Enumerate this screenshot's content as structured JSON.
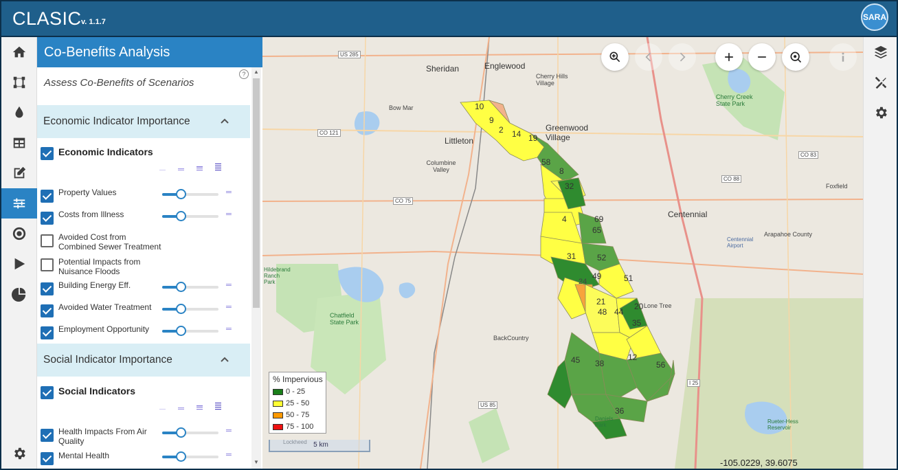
{
  "app": {
    "title": "CLASIC",
    "version": "v. 1.1.7",
    "user_initials": "SARA"
  },
  "left_rail": {
    "items": [
      {
        "icon": "home-icon"
      },
      {
        "icon": "boundary-icon"
      },
      {
        "icon": "water-drop-icon"
      },
      {
        "icon": "table-icon"
      },
      {
        "icon": "edit-icon"
      },
      {
        "icon": "sliders-icon",
        "active": true
      },
      {
        "icon": "target-icon"
      },
      {
        "icon": "play-icon"
      },
      {
        "icon": "pie-chart-icon"
      }
    ],
    "bottom_icon": "settings-icon"
  },
  "panel": {
    "title": "Co-Benefits Analysis",
    "subtitle": "Assess Co-Benefits of Scenarios",
    "help": "?",
    "economic": {
      "title": "Economic Indicator Importance",
      "group_label": "Economic Indicators",
      "group_checked": true,
      "items": [
        {
          "label": "Property Values",
          "checked": true,
          "slider": 0.33
        },
        {
          "label": "Costs from Illness",
          "checked": true,
          "slider": 0.33
        },
        {
          "label": "Avoided Cost from Combined Sewer Treatment",
          "checked": false
        },
        {
          "label": "Potential Impacts from Nuisance Floods",
          "checked": false
        },
        {
          "label": "Building Energy Eff.",
          "checked": true,
          "slider": 0.33
        },
        {
          "label": "Avoided Water Treatment",
          "checked": true,
          "slider": 0.33
        },
        {
          "label": "Employment Opportunity",
          "checked": true,
          "slider": 0.33
        }
      ]
    },
    "social": {
      "title": "Social Indicator Importance",
      "group_label": "Social Indicators",
      "group_checked": true,
      "items": [
        {
          "label": "Health Impacts From Air Quality",
          "checked": true,
          "slider": 0.33
        },
        {
          "label": "Mental Health",
          "checked": true,
          "slider": 0.33
        }
      ]
    }
  },
  "map": {
    "controls": [
      "zoom-extent-icon",
      "back-icon",
      "forward-icon",
      "zoom-in-icon",
      "zoom-out-icon",
      "locate-icon",
      "info-icon"
    ],
    "place_labels": {
      "sheridan": "Sheridan",
      "englewood": "Englewood",
      "cherry_hills": "Cherry Hills Village",
      "bow_mar": "Bow Mar",
      "littleton": "Littleton",
      "greenwood": "Greenwood Village",
      "columbine": "Columbine Valley",
      "centennial": "Centennial",
      "foxfield": "Foxfield",
      "cherry_creek": "Cherry Creek State Park",
      "chatfield": "Chatfield State Park",
      "hildebrand": "Hildebrand Ranch Park",
      "lone_tree": "Lone Tree",
      "arapahoe": "Arapahoe County",
      "airport": "Centennial Airport",
      "back_country": "BackCountry",
      "daniels": "Daniels Park",
      "rueter_hess": "Rueter-Hess Reservoir",
      "lockheed": "Lockheed"
    },
    "road_labels": {
      "us285": "US 285",
      "co121": "CO 121",
      "co75": "CO 75",
      "co88": "CO 88",
      "co83": "CO 83",
      "i25": "I 25",
      "us85": "US 85"
    },
    "subcatchments": [
      "10",
      "9",
      "2",
      "14",
      "19",
      "58",
      "8",
      "32",
      "4",
      "69",
      "65",
      "31",
      "52",
      "49",
      "24",
      "51",
      "21",
      "48",
      "44",
      "20",
      "35",
      "45",
      "38",
      "12",
      "56",
      "36"
    ],
    "legend": {
      "title": "% Impervious",
      "classes": [
        {
          "label": "0 - 25",
          "color": "#1a7f1a"
        },
        {
          "label": "25 - 50",
          "color": "#ffff33"
        },
        {
          "label": "50 - 75",
          "color": "#ff9900"
        },
        {
          "label": "75 - 100",
          "color": "#ee1111"
        }
      ]
    },
    "scale": "5 km",
    "coordinates": "-105.0229, 39.6075"
  },
  "right_rail": {
    "items": [
      "layers-icon",
      "tools-icon",
      "settings-icon"
    ]
  }
}
